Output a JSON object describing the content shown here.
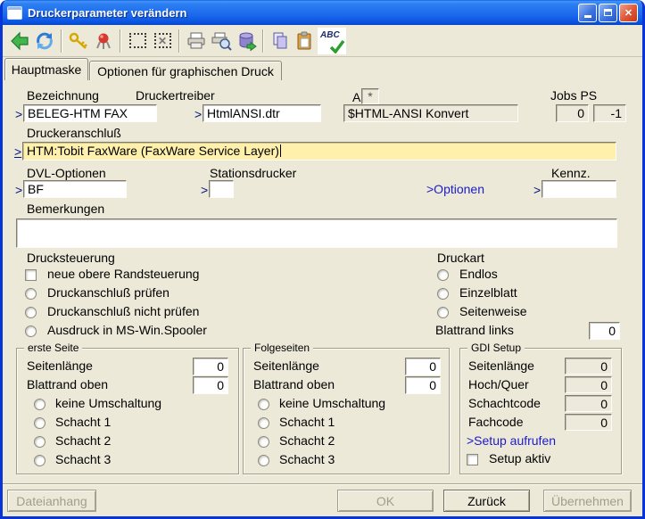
{
  "window": {
    "title": "Druckerparameter verändern"
  },
  "titlebar": {
    "minimize": "minimize",
    "maximize": "maximize",
    "close": "close"
  },
  "toolbar": {
    "icons": [
      {
        "name": "back-icon"
      },
      {
        "name": "refresh-icon"
      },
      {
        "name": "key-icon"
      },
      {
        "name": "pin-icon"
      },
      {
        "name": "selection-icon"
      },
      {
        "name": "clear-selection-icon",
        "glyph": "✕"
      },
      {
        "name": "print-icon"
      },
      {
        "name": "print-preview-icon"
      },
      {
        "name": "database-export-icon"
      },
      {
        "name": "copy-icon"
      },
      {
        "name": "paste-icon"
      },
      {
        "name": "spellcheck-icon",
        "text": "ABC"
      }
    ]
  },
  "tabs": [
    {
      "label": "Hauptmaske",
      "active": true
    },
    {
      "label": "Optionen für graphischen Druck",
      "active": false
    }
  ],
  "form": {
    "bezeichnung": {
      "label": "Bezeichnung",
      "prefix": ">",
      "value": "BELEG-HTM FAX"
    },
    "druckertreiber": {
      "label": "Druckertreiber",
      "prefix": ">",
      "value": "HtmlANSI.dtr"
    },
    "a_field": {
      "label": "A",
      "value": "*"
    },
    "konvert": {
      "value": "$HTML-ANSI Konvert"
    },
    "jobs_ps": {
      "label": "Jobs PS",
      "jobs": "0",
      "ps": "-1"
    },
    "druckeranschluss": {
      "label": "Druckeranschluß",
      "prefix": ">",
      "value": "HTM:Tobit FaxWare (FaxWare Service Layer)"
    },
    "dvl_optionen": {
      "label": "DVL-Optionen",
      "prefix": ">",
      "value": "BF"
    },
    "stationsdrucker": {
      "label": "Stationsdrucker",
      "prefix": ">",
      "value": ""
    },
    "optionen_link": ">Optionen",
    "kennz": {
      "label": "Kennz.",
      "prefix": ">",
      "value": ""
    },
    "bemerkungen": {
      "label": "Bemerkungen",
      "value": ""
    },
    "drucksteuerung": {
      "title": "Drucksteuerung",
      "options": [
        {
          "type": "checkbox",
          "label": "neue obere Randsteuerung",
          "checked": false
        },
        {
          "type": "radio",
          "label": "Druckanschluß prüfen",
          "checked": false
        },
        {
          "type": "radio",
          "label": "Druckanschluß nicht prüfen",
          "checked": false
        },
        {
          "type": "radio",
          "label": "Ausdruck in MS-Win.Spooler",
          "checked": false
        }
      ]
    },
    "druckart": {
      "title": "Druckart",
      "options": [
        {
          "type": "radio",
          "label": "Endlos",
          "checked": false
        },
        {
          "type": "radio",
          "label": "Einzelblatt",
          "checked": false
        },
        {
          "type": "radio",
          "label": "Seitenweise",
          "checked": false
        }
      ],
      "blattrand_links": {
        "label": "Blattrand links",
        "value": "0"
      }
    },
    "erste_seite": {
      "title": "erste Seite",
      "seitenlaenge": {
        "label": "Seitenlänge",
        "value": "0"
      },
      "blattrand_oben": {
        "label": "Blattrand oben",
        "value": "0"
      },
      "options": [
        {
          "label": "keine Umschaltung",
          "checked": false
        },
        {
          "label": "Schacht 1",
          "checked": false
        },
        {
          "label": "Schacht 2",
          "checked": false
        },
        {
          "label": "Schacht 3",
          "checked": false
        }
      ]
    },
    "folgeseiten": {
      "title": "Folgeseiten",
      "seitenlaenge": {
        "label": "Seitenlänge",
        "value": "0"
      },
      "blattrand_oben": {
        "label": "Blattrand oben",
        "value": "0"
      },
      "options": [
        {
          "label": "keine Umschaltung",
          "checked": false
        },
        {
          "label": "Schacht 1",
          "checked": false
        },
        {
          "label": "Schacht 2",
          "checked": false
        },
        {
          "label": "Schacht 3",
          "checked": false
        }
      ]
    },
    "gdi_setup": {
      "title": "GDI Setup",
      "rows": [
        {
          "label": "Seitenlänge",
          "value": "0"
        },
        {
          "label": "Hoch/Quer",
          "value": "0"
        },
        {
          "label": "Schachtcode",
          "value": "0"
        },
        {
          "label": "Fachcode",
          "value": "0"
        }
      ],
      "setup_link": ">Setup aufrufen",
      "setup_aktiv": {
        "label": "Setup aktiv",
        "checked": false
      }
    }
  },
  "footer": {
    "buttons": [
      {
        "label": "Dateianhang",
        "enabled": false
      },
      {
        "label": "OK",
        "enabled": false
      },
      {
        "label": "Zurück",
        "enabled": true
      },
      {
        "label": "Übernehmen",
        "enabled": false
      }
    ]
  },
  "colors": {
    "face": "#ECE9D8",
    "focus_field": "#FFF1AC",
    "titlebar_blue": "#1B69EC",
    "window_border": "#0834D8",
    "link_blue": "#1C1CC8"
  }
}
